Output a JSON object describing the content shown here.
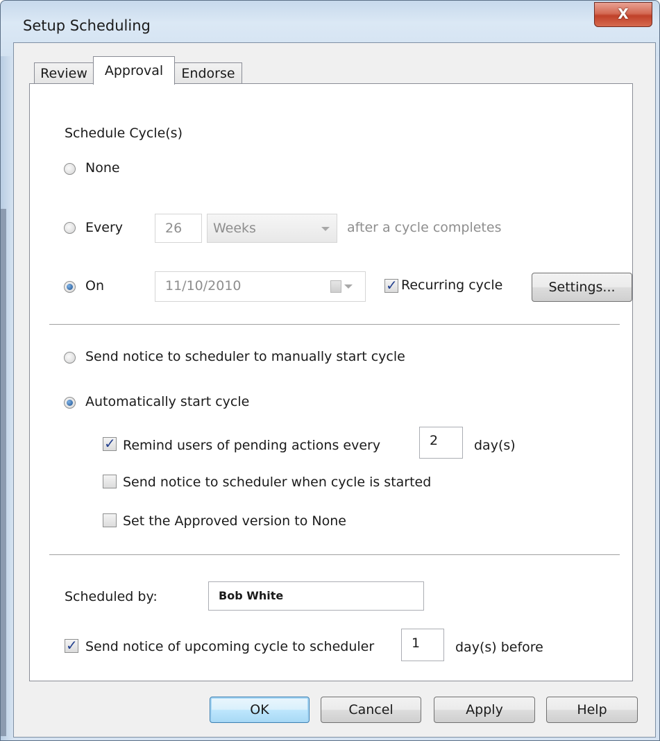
{
  "window": {
    "title": "Setup Scheduling",
    "close_glyph": "X"
  },
  "tabs": [
    {
      "label": "Review",
      "active": false
    },
    {
      "label": "Approval",
      "active": true
    },
    {
      "label": "Endorse",
      "active": false
    }
  ],
  "schedule": {
    "heading": "Schedule Cycle(s)",
    "none_label": "None",
    "every_label": "Every",
    "every_value": "26",
    "every_unit": "Weeks",
    "every_suffix": "after a cycle completes",
    "on_label": "On",
    "on_date": "11/10/2010",
    "recurring_label": "Recurring cycle",
    "recurring_checked": true,
    "settings_button": "Settings...",
    "selected": "On"
  },
  "start": {
    "manual_label": "Send notice to scheduler to manually start cycle",
    "auto_label": "Automatically start cycle",
    "selected": "Automatically start cycle",
    "remind_label": "Remind users of pending actions every",
    "remind_checked": true,
    "remind_value": "2",
    "remind_unit": "day(s)",
    "notice_started_label": "Send notice to scheduler when cycle is started",
    "notice_started_checked": false,
    "approved_none_label": "Set the Approved version to None",
    "approved_none_checked": false
  },
  "footer_fields": {
    "scheduled_by_label": "Scheduled by:",
    "scheduled_by_value": "Bob White",
    "upcoming_label": "Send notice of upcoming cycle to scheduler",
    "upcoming_checked": true,
    "upcoming_value": "1",
    "upcoming_unit": "day(s) before"
  },
  "buttons": {
    "ok": "OK",
    "cancel": "Cancel",
    "apply": "Apply",
    "help": "Help"
  },
  "icons": {
    "calendar": "calendar-icon",
    "dropdown": "chevron-down-icon",
    "check": "checkmark-icon"
  }
}
